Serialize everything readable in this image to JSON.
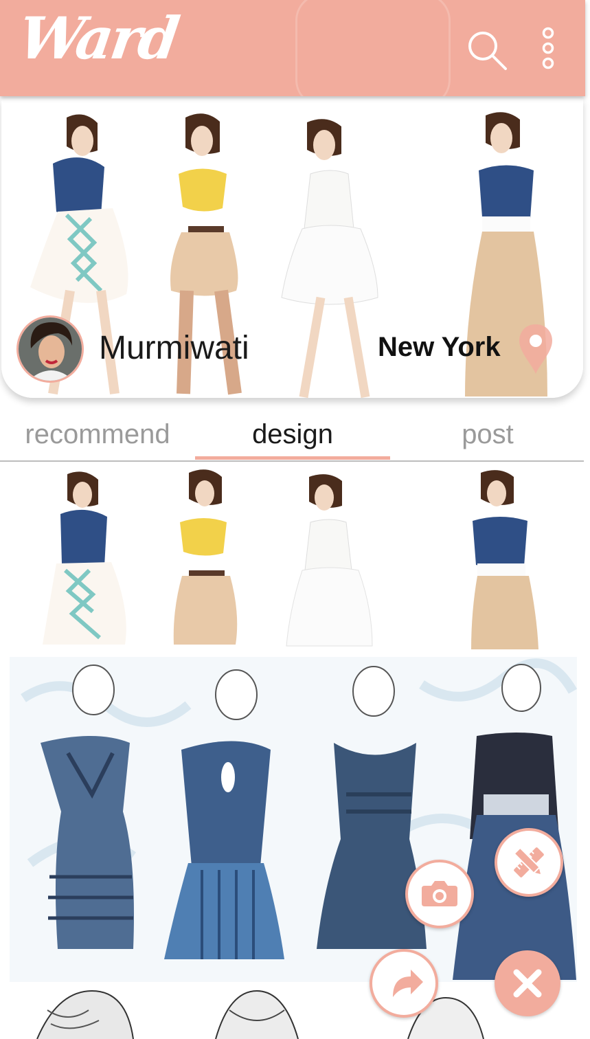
{
  "app": {
    "logo_text": "Ward",
    "brand_color": "#f2ac9d"
  },
  "header": {
    "icons": [
      "search-icon",
      "more-vertical-icon"
    ]
  },
  "profile": {
    "username": "Murmiwati",
    "location": "New York",
    "location_icon": "location-pin-icon"
  },
  "tabs": [
    {
      "label": "recommend",
      "active": false
    },
    {
      "label": "design",
      "active": true
    },
    {
      "label": "post",
      "active": false
    }
  ],
  "feed": {
    "items": [
      {
        "kind": "fashion-sketch-colored"
      },
      {
        "kind": "fashion-sketch-blue-dresses"
      },
      {
        "kind": "fashion-sketch-pencil"
      }
    ]
  },
  "fab": {
    "actions": [
      "camera-icon",
      "pencil-ruler-icon",
      "share-icon",
      "close-icon"
    ]
  }
}
